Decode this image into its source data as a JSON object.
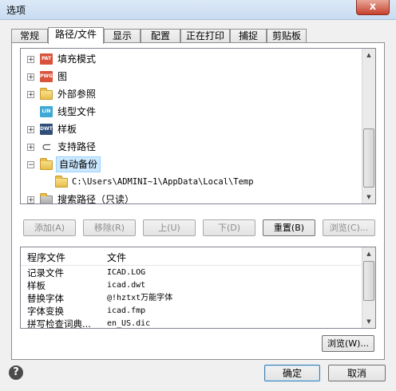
{
  "window": {
    "title": "选项",
    "close_label": "x"
  },
  "tabs": [
    "常规",
    "路径/文件",
    "显示",
    "配置",
    "正在打印",
    "捕捉",
    "剪贴板"
  ],
  "tree": {
    "items": [
      {
        "label": "填充模式",
        "icon": "pat-file-icon",
        "icon_text": "PAT",
        "icon_color": "#d9533c"
      },
      {
        "label": "图",
        "icon": "pwg-file-icon",
        "icon_text": "PWG",
        "icon_color": "#d9533c"
      },
      {
        "label": "外部参照",
        "icon": "folder-icon"
      },
      {
        "label": "线型文件",
        "icon": "lin-file-icon",
        "icon_text": "LIN",
        "icon_color": "#3fa9d6"
      },
      {
        "label": "样板",
        "icon": "dwt-file-icon",
        "icon_text": "DWT",
        "icon_color": "#2f4e78"
      },
      {
        "label": "支持路径",
        "icon": "paperclip-icon"
      },
      {
        "label": "自动备份",
        "icon": "folder-open-icon"
      },
      {
        "label": "C:\\Users\\ADMINI~1\\AppData\\Local\\Temp",
        "icon": "folder-icon"
      },
      {
        "label": "搜索路径（只读）",
        "icon": "folder-icon"
      }
    ]
  },
  "buttons": {
    "add": "添加(A)",
    "remove": "移除(R)",
    "up": "上(U)",
    "down": "下(D)",
    "reset": "重置(B)",
    "browse_top": "浏览(C)...",
    "browse_bottom": "浏览(W)...",
    "ok": "确定",
    "cancel": "取消"
  },
  "list": {
    "columns": [
      "程序文件",
      "文件"
    ],
    "rows": [
      [
        "记录文件",
        "ICAD.LOG"
      ],
      [
        "样板",
        "icad.dwt"
      ],
      [
        "替换字体",
        "@!hztxt万能字体"
      ],
      [
        "字体变换",
        "icad.fmp"
      ],
      [
        "拼写检查词典...",
        "en_US.dic"
      ]
    ]
  },
  "help_label": "?"
}
